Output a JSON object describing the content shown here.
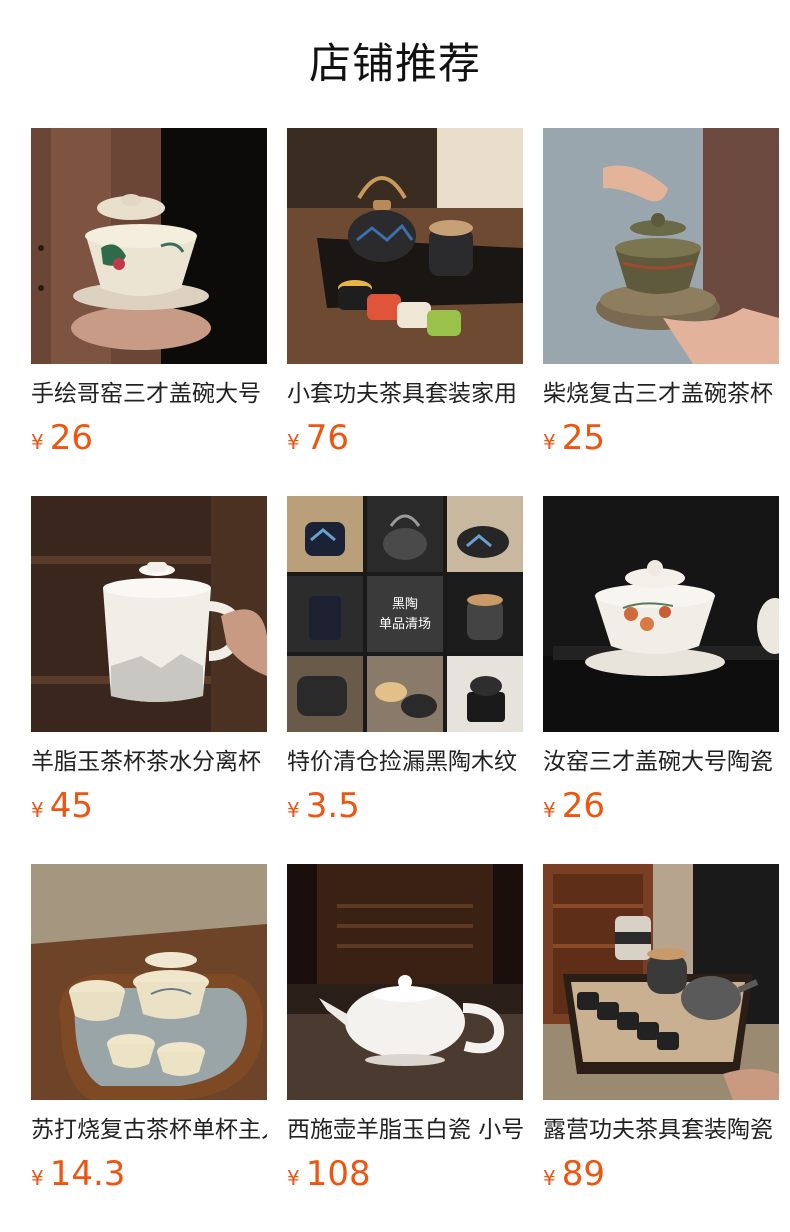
{
  "section": {
    "title": "店铺推荐"
  },
  "currency_symbol": "¥",
  "theme": {
    "price_color": "#ee5511"
  },
  "products": [
    {
      "name": "手绘哥窑三才盖碗大号",
      "price": "26",
      "image": "hand-painted-gaiwan-photo"
    },
    {
      "name": "小套功夫茶具套装家用",
      "price": "76",
      "image": "kungfu-tea-set-photo"
    },
    {
      "name": "柴烧复古三才盖碗茶杯",
      "price": "25",
      "image": "wood-fired-gaiwan-photo"
    },
    {
      "name": "羊脂玉茶杯茶水分离杯",
      "price": "45",
      "image": "white-porcelain-mug-photo"
    },
    {
      "name": "特价清仓捡漏黑陶木纹",
      "price": "3.5",
      "image": "black-pottery-clearance-collage",
      "overlay_text": [
        "黑陶",
        "单品清场"
      ]
    },
    {
      "name": "汝窑三才盖碗大号陶瓷",
      "price": "26",
      "image": "ru-kiln-gaiwan-photo"
    },
    {
      "name": "苏打烧复古茶杯单杯主人杯",
      "price": "14.3",
      "image": "soda-fired-cups-photo"
    },
    {
      "name": "西施壶羊脂玉白瓷 小号",
      "price": "108",
      "image": "xishi-teapot-photo"
    },
    {
      "name": "露营功夫茶具套装陶瓷",
      "price": "89",
      "image": "camping-tea-set-photo"
    }
  ]
}
